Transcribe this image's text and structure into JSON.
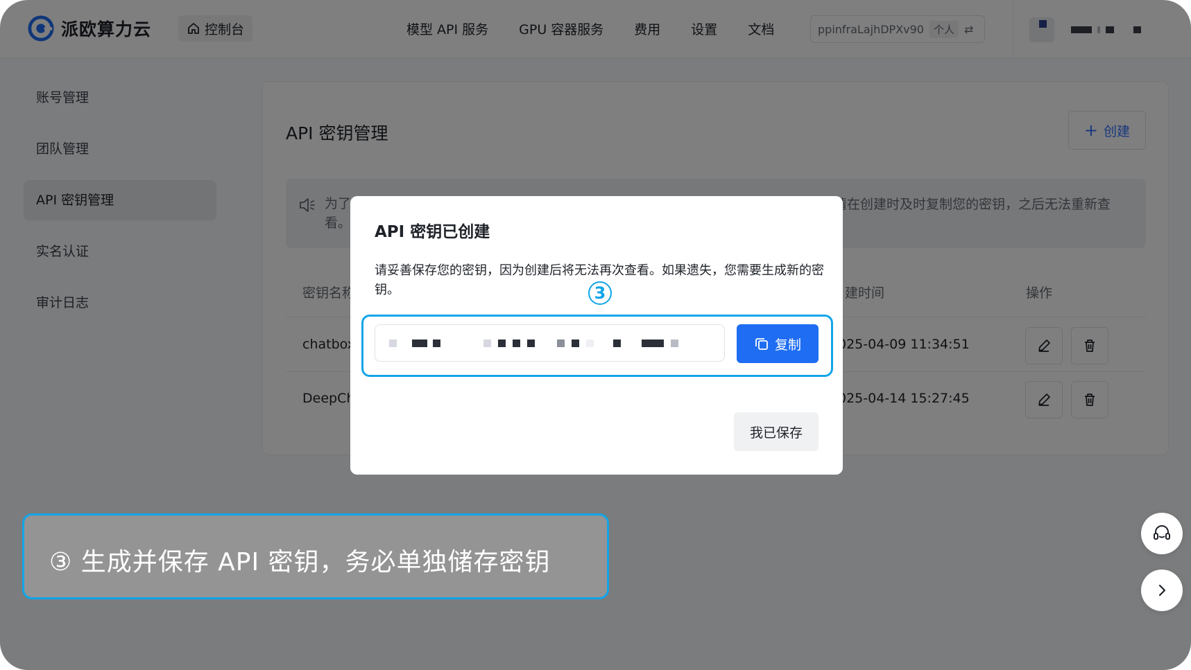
{
  "brand": {
    "name": "派欧算力云",
    "accent": "#1f6df2"
  },
  "header": {
    "console_label": "控制台",
    "nav": [
      "模型 API 服务",
      "GPU 容器服务",
      "费用",
      "设置",
      "文档"
    ],
    "account_id": "ppinfraLajhDPXv90",
    "account_type": "个人",
    "switch_icon": "⇄"
  },
  "sidebar": {
    "items": [
      {
        "label": "账号管理",
        "active": false
      },
      {
        "label": "团队管理",
        "active": false
      },
      {
        "label": "API 密钥管理",
        "active": true
      },
      {
        "label": "实名认证",
        "active": false
      },
      {
        "label": "审计日志",
        "active": false
      }
    ]
  },
  "page": {
    "title": "API 密钥管理",
    "create_label": "创建",
    "notice_left_line1": "为了",
    "notice_left_line2": "看。",
    "notice_right": "请在创建时及时复制您的密钥，之后无法重新查",
    "columns": {
      "name": "密钥名称",
      "created": "建时间",
      "actions": "操作"
    },
    "rows": [
      {
        "name": "chatbox",
        "created": "025-04-09 11:34:51"
      },
      {
        "name": "DeepCh",
        "created": "025-04-14 15:27:45"
      }
    ]
  },
  "modal": {
    "title": "API 密钥已创建",
    "description": "请妥善保存您的密钥，因为创建后将无法再次查看。如果遗失，您需要生成新的密钥。",
    "step_marker": "3",
    "copy_label": "复制",
    "saved_label": "我已保存"
  },
  "caption": {
    "text": "③ 生成并保存 API 密钥，务必单独储存密钥"
  },
  "colors": {
    "highlight": "#12a5e8",
    "primary": "#1f6df2"
  }
}
